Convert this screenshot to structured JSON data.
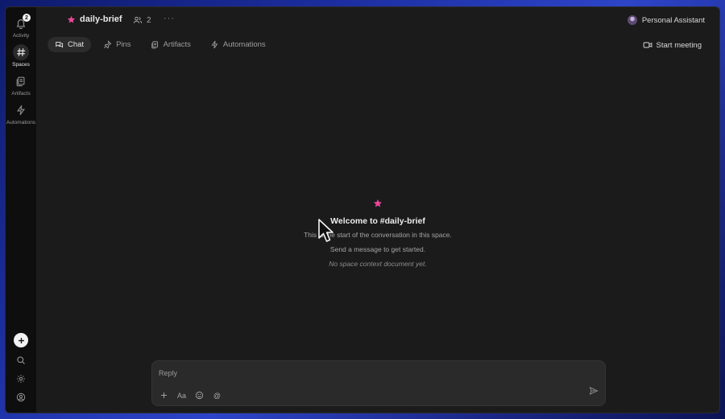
{
  "rail": {
    "activity": {
      "label": "Activity",
      "badge": "2"
    },
    "spaces": {
      "label": "Spaces"
    },
    "artifacts": {
      "label": "Artifacts"
    },
    "automations": {
      "label": "Automations"
    }
  },
  "header": {
    "space_name": "daily-brief",
    "member_count": "2",
    "more": "···",
    "assistant_name": "Personal Assistant"
  },
  "tabs": [
    {
      "label": "Chat",
      "active": true
    },
    {
      "label": "Pins"
    },
    {
      "label": "Artifacts"
    },
    {
      "label": "Automations"
    }
  ],
  "meeting_label": "Start meeting",
  "welcome": {
    "title": "Welcome to #daily-brief",
    "line1": "This is the start of the conversation in this space.",
    "line2": "Send a message to get started.",
    "note": "No space context document yet."
  },
  "composer": {
    "placeholder": "Reply",
    "tools": {
      "format_label": "Aa",
      "mention_label": "@"
    }
  },
  "colors": {
    "accent_star": "#e8479a",
    "window_bg": "#1b1b1b",
    "rail_bg": "#0e0e0e",
    "desktop_bg": "#2d44c8"
  }
}
